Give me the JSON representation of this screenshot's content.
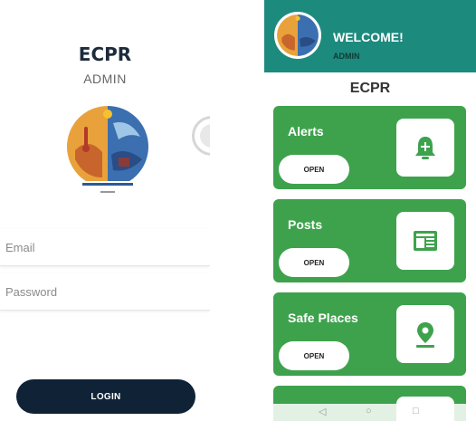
{
  "login": {
    "title": "ECPR",
    "subtitle": "ADMIN",
    "email_placeholder": "Email",
    "password_placeholder": "Password",
    "login_button": "LOGIN"
  },
  "dashboard": {
    "welcome": "WELCOME!",
    "role": "ADMIN",
    "title": "ECPR",
    "cards": [
      {
        "label": "Alerts",
        "button": "OPEN",
        "icon": "bell-plus-icon"
      },
      {
        "label": "Posts",
        "button": "OPEN",
        "icon": "newspaper-icon"
      },
      {
        "label": "Safe Places",
        "button": "OPEN",
        "icon": "map-pin-icon"
      },
      {
        "label": "",
        "button": "",
        "icon": ""
      }
    ],
    "nav": {
      "back": "◁",
      "home": "○",
      "recent": "□"
    }
  },
  "colors": {
    "header": "#1d8a7e",
    "card": "#3ea24d",
    "login_button": "#0f2236",
    "title": "#1d2b3c"
  }
}
